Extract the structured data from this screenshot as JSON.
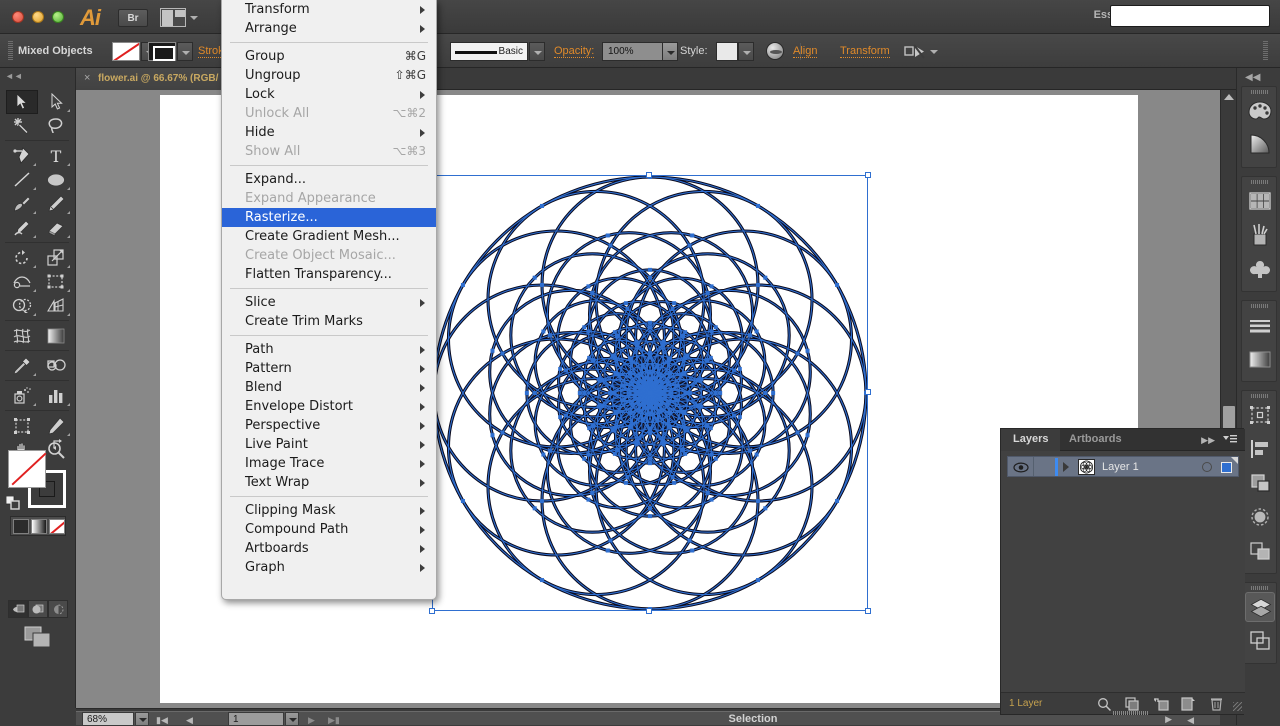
{
  "titlebar": {
    "app_name": "Ai",
    "bridge_button": "Br",
    "workspace": "Essentials",
    "search_value": ""
  },
  "control_bar": {
    "selection_label": "Mixed Objects",
    "stroke_label": "Stroke:",
    "brush_label": "Basic",
    "opacity_label": "Opacity:",
    "opacity_value": "100%",
    "style_label": "Style:",
    "align_label": "Align",
    "transform_label": "Transform"
  },
  "document_tab": {
    "close_glyph": "×",
    "title": "flower.ai @ 66.67% (RGB/"
  },
  "context_menu": {
    "items": [
      {
        "label": "Transform",
        "shortcut": "",
        "submenu": true,
        "disabled": false,
        "highlight": false
      },
      {
        "label": "Arrange",
        "shortcut": "",
        "submenu": true,
        "disabled": false,
        "highlight": false
      },
      {
        "separator": true
      },
      {
        "label": "Group",
        "shortcut": "⌘G",
        "submenu": false,
        "disabled": false,
        "highlight": false
      },
      {
        "label": "Ungroup",
        "shortcut": "⇧⌘G",
        "submenu": false,
        "disabled": false,
        "highlight": false
      },
      {
        "label": "Lock",
        "shortcut": "",
        "submenu": true,
        "disabled": false,
        "highlight": false
      },
      {
        "label": "Unlock All",
        "shortcut": "⌥⌘2",
        "submenu": false,
        "disabled": true,
        "highlight": false
      },
      {
        "label": "Hide",
        "shortcut": "",
        "submenu": true,
        "disabled": false,
        "highlight": false
      },
      {
        "label": "Show All",
        "shortcut": "⌥⌘3",
        "submenu": false,
        "disabled": true,
        "highlight": false
      },
      {
        "separator": true
      },
      {
        "label": "Expand...",
        "shortcut": "",
        "submenu": false,
        "disabled": false,
        "highlight": false
      },
      {
        "label": "Expand Appearance",
        "shortcut": "",
        "submenu": false,
        "disabled": true,
        "highlight": false
      },
      {
        "label": "Rasterize...",
        "shortcut": "",
        "submenu": false,
        "disabled": false,
        "highlight": true
      },
      {
        "label": "Create Gradient Mesh...",
        "shortcut": "",
        "submenu": false,
        "disabled": false,
        "highlight": false
      },
      {
        "label": "Create Object Mosaic...",
        "shortcut": "",
        "submenu": false,
        "disabled": true,
        "highlight": false
      },
      {
        "label": "Flatten Transparency...",
        "shortcut": "",
        "submenu": false,
        "disabled": false,
        "highlight": false
      },
      {
        "separator": true
      },
      {
        "label": "Slice",
        "shortcut": "",
        "submenu": true,
        "disabled": false,
        "highlight": false
      },
      {
        "label": "Create Trim Marks",
        "shortcut": "",
        "submenu": false,
        "disabled": false,
        "highlight": false
      },
      {
        "separator": true
      },
      {
        "label": "Path",
        "shortcut": "",
        "submenu": true,
        "disabled": false,
        "highlight": false
      },
      {
        "label": "Pattern",
        "shortcut": "",
        "submenu": true,
        "disabled": false,
        "highlight": false
      },
      {
        "label": "Blend",
        "shortcut": "",
        "submenu": true,
        "disabled": false,
        "highlight": false
      },
      {
        "label": "Envelope Distort",
        "shortcut": "",
        "submenu": true,
        "disabled": false,
        "highlight": false
      },
      {
        "label": "Perspective",
        "shortcut": "",
        "submenu": true,
        "disabled": false,
        "highlight": false
      },
      {
        "label": "Live Paint",
        "shortcut": "",
        "submenu": true,
        "disabled": false,
        "highlight": false
      },
      {
        "label": "Image Trace",
        "shortcut": "",
        "submenu": true,
        "disabled": false,
        "highlight": false
      },
      {
        "label": "Text Wrap",
        "shortcut": "",
        "submenu": true,
        "disabled": false,
        "highlight": false
      },
      {
        "separator": true
      },
      {
        "label": "Clipping Mask",
        "shortcut": "",
        "submenu": true,
        "disabled": false,
        "highlight": false
      },
      {
        "label": "Compound Path",
        "shortcut": "",
        "submenu": true,
        "disabled": false,
        "highlight": false
      },
      {
        "label": "Artboards",
        "shortcut": "",
        "submenu": true,
        "disabled": false,
        "highlight": false
      },
      {
        "label": "Graph",
        "shortcut": "",
        "submenu": true,
        "disabled": false,
        "highlight": false
      }
    ]
  },
  "tools": [
    {
      "name": "selection-tool",
      "selected": true
    },
    {
      "name": "direct-selection-tool",
      "selected": false
    },
    {
      "name": "magic-wand-tool",
      "selected": false
    },
    {
      "name": "lasso-tool",
      "selected": false
    },
    {
      "name": "pen-tool",
      "selected": false
    },
    {
      "name": "type-tool",
      "selected": false
    },
    {
      "name": "line-segment-tool",
      "selected": false
    },
    {
      "name": "ellipse-tool",
      "selected": false
    },
    {
      "name": "paintbrush-tool",
      "selected": false
    },
    {
      "name": "pencil-tool",
      "selected": false
    },
    {
      "name": "blob-brush-tool",
      "selected": false
    },
    {
      "name": "eraser-tool",
      "selected": false
    },
    {
      "name": "rotate-tool",
      "selected": false
    },
    {
      "name": "scale-tool",
      "selected": false
    },
    {
      "name": "width-tool",
      "selected": false
    },
    {
      "name": "free-transform-tool",
      "selected": false
    },
    {
      "name": "shape-builder-tool",
      "selected": false
    },
    {
      "name": "perspective-grid-tool",
      "selected": false
    },
    {
      "name": "mesh-tool",
      "selected": false
    },
    {
      "name": "gradient-tool",
      "selected": false
    },
    {
      "name": "eyedropper-tool",
      "selected": false
    },
    {
      "name": "blend-tool",
      "selected": false
    },
    {
      "name": "symbol-sprayer-tool",
      "selected": false
    },
    {
      "name": "column-graph-tool",
      "selected": false
    },
    {
      "name": "artboard-tool",
      "selected": false
    },
    {
      "name": "slice-tool",
      "selected": false
    },
    {
      "name": "hand-tool",
      "selected": false
    },
    {
      "name": "zoom-tool",
      "selected": false
    }
  ],
  "layers_panel": {
    "tabs": [
      {
        "label": "Layers",
        "active": true
      },
      {
        "label": "Artboards",
        "active": false
      }
    ],
    "rows": [
      {
        "name": "Layer 1",
        "visible": true,
        "locked": false,
        "selected": true
      }
    ],
    "footer_count": "1 Layer",
    "footer_icons": [
      "locate-object-icon",
      "make-clipping-mask-icon",
      "create-sublayer-icon",
      "create-new-layer-icon",
      "delete-selection-icon"
    ]
  },
  "right_dock": {
    "groups": [
      {
        "icons": [
          "color-panel-icon",
          "color-guide-icon"
        ]
      },
      {
        "icons": [
          "swatches-panel-icon",
          "brushes-panel-icon",
          "symbols-panel-icon"
        ]
      },
      {
        "icons": [
          "stroke-panel-icon",
          "gradient-panel-icon"
        ]
      },
      {
        "icons": [
          "transform-panel-icon",
          "align-panel-icon",
          "pathfinder-panel-icon",
          "transparency-panel-icon",
          "appearance-panel-icon"
        ]
      },
      {
        "icons": [
          "layers-panel-icon",
          "artboards-panel-icon"
        ]
      }
    ]
  },
  "status_bar": {
    "zoom_value": "68%",
    "page_value": "1",
    "status_text": "Selection"
  },
  "artwork": {
    "name": "flower-mandala",
    "stroke_color": "#0a0a1e",
    "path_color": "#2f6fd0",
    "selection_color": "#2f6fd0",
    "rings": 9,
    "petals_per_ring": 12
  }
}
